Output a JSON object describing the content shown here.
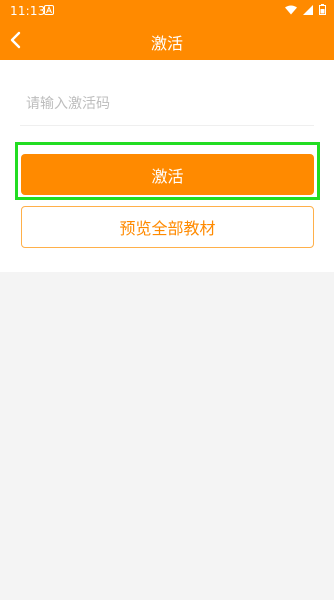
{
  "status_bar": {
    "time": "11:13",
    "icons": [
      "a-notification-icon",
      "wifi-icon",
      "signal-icon",
      "battery-icon"
    ]
  },
  "app_bar": {
    "title": "激活",
    "back_icon": "chevron-left-icon"
  },
  "form": {
    "code_input": {
      "value": "",
      "placeholder": "请输入激活码"
    },
    "activate_label": "激活",
    "preview_label": "预览全部教材"
  },
  "colors": {
    "accent": "#ff8a00",
    "highlight": "#22dd22",
    "background": "#f4f4f4"
  }
}
